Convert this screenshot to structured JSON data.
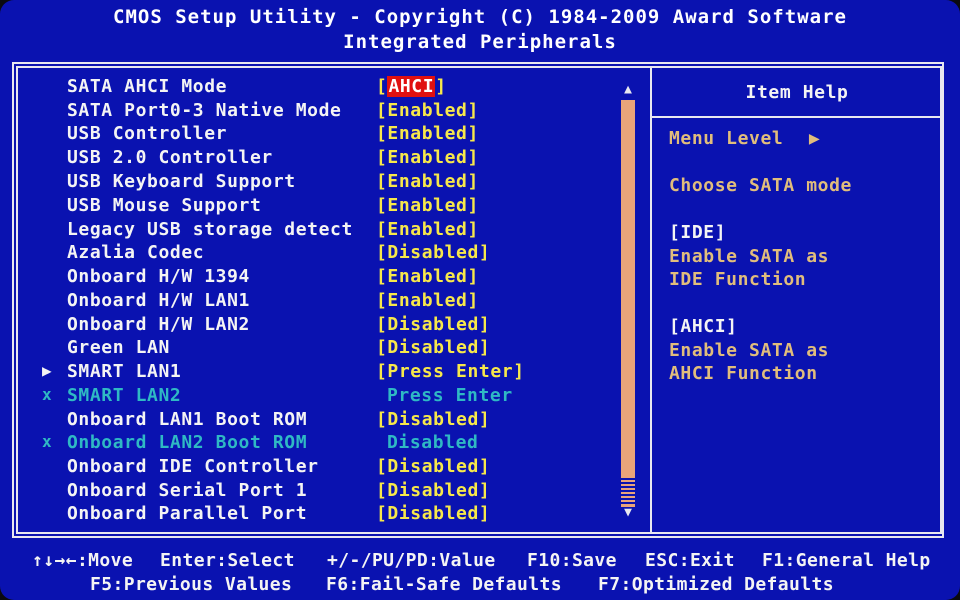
{
  "header": {
    "title": "CMOS Setup Utility - Copyright (C) 1984-2009 Award Software",
    "subtitle": "Integrated Peripherals"
  },
  "menu": {
    "items": [
      {
        "label": "SATA AHCI Mode",
        "value_prefix": "[",
        "value": "AHCI",
        "value_suffix": "]",
        "selected": true,
        "dim": false,
        "marker": ""
      },
      {
        "label": "SATA Port0-3 Native Mode",
        "value": "[Enabled]",
        "dim": false,
        "marker": ""
      },
      {
        "label": "USB Controller",
        "value": "[Enabled]",
        "dim": false,
        "marker": ""
      },
      {
        "label": "USB 2.0 Controller",
        "value": "[Enabled]",
        "dim": false,
        "marker": ""
      },
      {
        "label": "USB Keyboard Support",
        "value": "[Enabled]",
        "dim": false,
        "marker": ""
      },
      {
        "label": "USB Mouse Support",
        "value": "[Enabled]",
        "dim": false,
        "marker": ""
      },
      {
        "label": "Legacy USB storage detect",
        "value": "[Enabled]",
        "dim": false,
        "marker": ""
      },
      {
        "label": "Azalia Codec",
        "value": "[Disabled]",
        "dim": false,
        "marker": ""
      },
      {
        "label": "Onboard H/W 1394",
        "value": "[Enabled]",
        "dim": false,
        "marker": ""
      },
      {
        "label": "Onboard H/W LAN1",
        "value": "[Enabled]",
        "dim": false,
        "marker": ""
      },
      {
        "label": "Onboard H/W LAN2",
        "value": "[Disabled]",
        "dim": false,
        "marker": ""
      },
      {
        "label": "Green LAN",
        "value": "[Disabled]",
        "dim": false,
        "marker": ""
      },
      {
        "label": "SMART LAN1",
        "value": "[Press Enter]",
        "dim": false,
        "marker": "▶"
      },
      {
        "label": "SMART LAN2",
        "value": "Press Enter",
        "dim": true,
        "marker": "x"
      },
      {
        "label": "Onboard LAN1 Boot ROM",
        "value": "[Disabled]",
        "dim": false,
        "marker": ""
      },
      {
        "label": "Onboard LAN2 Boot ROM",
        "value": "Disabled",
        "dim": true,
        "marker": "x"
      },
      {
        "label": "Onboard IDE Controller",
        "value": "[Disabled]",
        "dim": false,
        "marker": ""
      },
      {
        "label": "Onboard Serial Port 1",
        "value": "[Disabled]",
        "dim": false,
        "marker": ""
      },
      {
        "label": "Onboard Parallel Port",
        "value": "[Disabled]",
        "dim": false,
        "marker": ""
      }
    ]
  },
  "scrollbar": {
    "up_arrow": "▲",
    "down_arrow": "▼"
  },
  "help": {
    "title": "Item Help",
    "menu_level": "Menu Level",
    "menu_level_arrow": "▶",
    "lines": [
      "Choose SATA mode",
      "[IDE]",
      "Enable SATA as",
      "IDE Function",
      "[AHCI]",
      "Enable SATA as",
      "AHCI Function"
    ]
  },
  "footer": {
    "line1": [
      "↑↓→←:Move",
      "Enter:Select",
      "+/-/PU/PD:Value",
      "F10:Save",
      "ESC:Exit",
      "F1:General Help"
    ],
    "line2": [
      "F5:Previous Values",
      "F6:Fail-Safe Defaults",
      "F7:Optimized Defaults"
    ]
  },
  "colors": {
    "background": "#0a12b0",
    "value_text": "#f7e84a",
    "disabled_text": "#2fb9c4",
    "help_text": "#e1bd7c",
    "selection": "#e01010"
  }
}
